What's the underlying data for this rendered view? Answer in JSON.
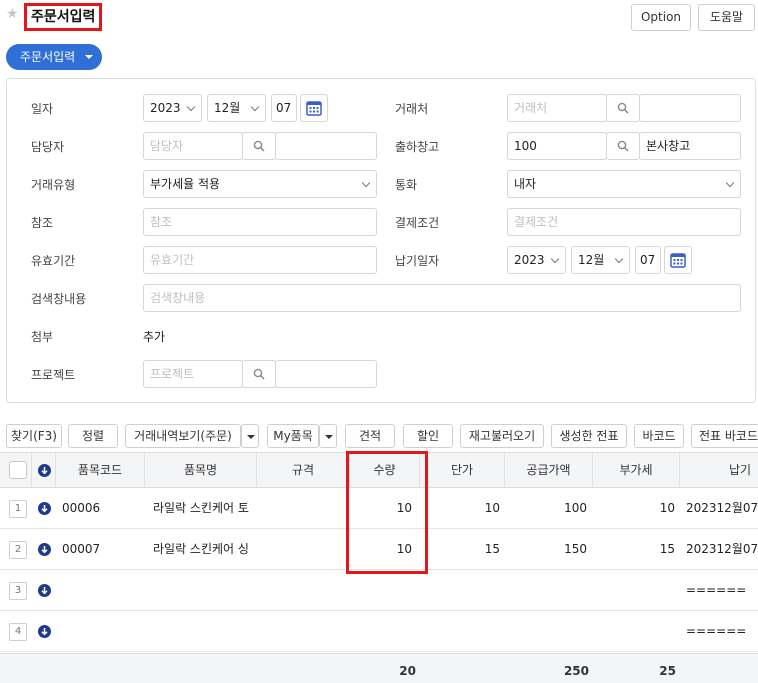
{
  "header": {
    "title": "주문서입력",
    "option_label": "Option",
    "help_label": "도움말"
  },
  "menu": {
    "label": "주문서입력"
  },
  "form": {
    "date_label": "일자",
    "date_year": "2023",
    "date_month": "12월",
    "date_day": "07",
    "customer_label": "거래처",
    "customer_placeholder": "거래처",
    "manager_label": "담당자",
    "manager_placeholder": "담당자",
    "warehouse_label": "출하창고",
    "warehouse_code": "100",
    "warehouse_name": "본사창고",
    "tradetype_label": "거래유형",
    "tradetype_value": "부가세율 적용",
    "currency_label": "통화",
    "currency_value": "내자",
    "reference_label": "참조",
    "reference_placeholder": "참조",
    "payment_label": "결제조건",
    "payment_placeholder": "결제조건",
    "validity_label": "유효기간",
    "validity_placeholder": "유효기간",
    "delivery_label": "납기일자",
    "delivery_year": "2023",
    "delivery_month": "12월",
    "delivery_day": "07",
    "searchwin_label": "검색창내용",
    "searchwin_placeholder": "검색창내용",
    "attach_label": "첨부",
    "attach_add": "추가",
    "project_label": "프로젝트",
    "project_placeholder": "프로젝트"
  },
  "toolbar": {
    "find": "찾기(F3)",
    "sort": "정렬",
    "history": "거래내역보기(주문)",
    "my_items": "My품목",
    "estimate": "견적",
    "discount": "할인",
    "reload_stock": "재고불러오기",
    "created_slip": "생성한 전표",
    "barcode": "바코드",
    "slip_barcode": "전표 바코드"
  },
  "grid": {
    "columns": [
      "품목코드",
      "품목명",
      "규격",
      "수량",
      "단가",
      "공급가액",
      "부가세",
      "납기"
    ],
    "rows": [
      {
        "no": "1",
        "code": "00006",
        "name": "라일락 스킨케어 토",
        "spec": "",
        "qty": "10",
        "price": "10",
        "supply": "100",
        "vat": "10",
        "due": "202312월07"
      },
      {
        "no": "2",
        "code": "00007",
        "name": "라일락 스킨케어 싱",
        "spec": "",
        "qty": "10",
        "price": "15",
        "supply": "150",
        "vat": "15",
        "due": "202312월07"
      },
      {
        "no": "3",
        "code": "",
        "name": "",
        "spec": "",
        "qty": "",
        "price": "",
        "supply": "",
        "vat": "",
        "due": "======"
      },
      {
        "no": "4",
        "code": "",
        "name": "",
        "spec": "",
        "qty": "",
        "price": "",
        "supply": "",
        "vat": "",
        "due": "======"
      }
    ],
    "totals": {
      "qty": "20",
      "supply": "250",
      "vat": "25"
    }
  }
}
